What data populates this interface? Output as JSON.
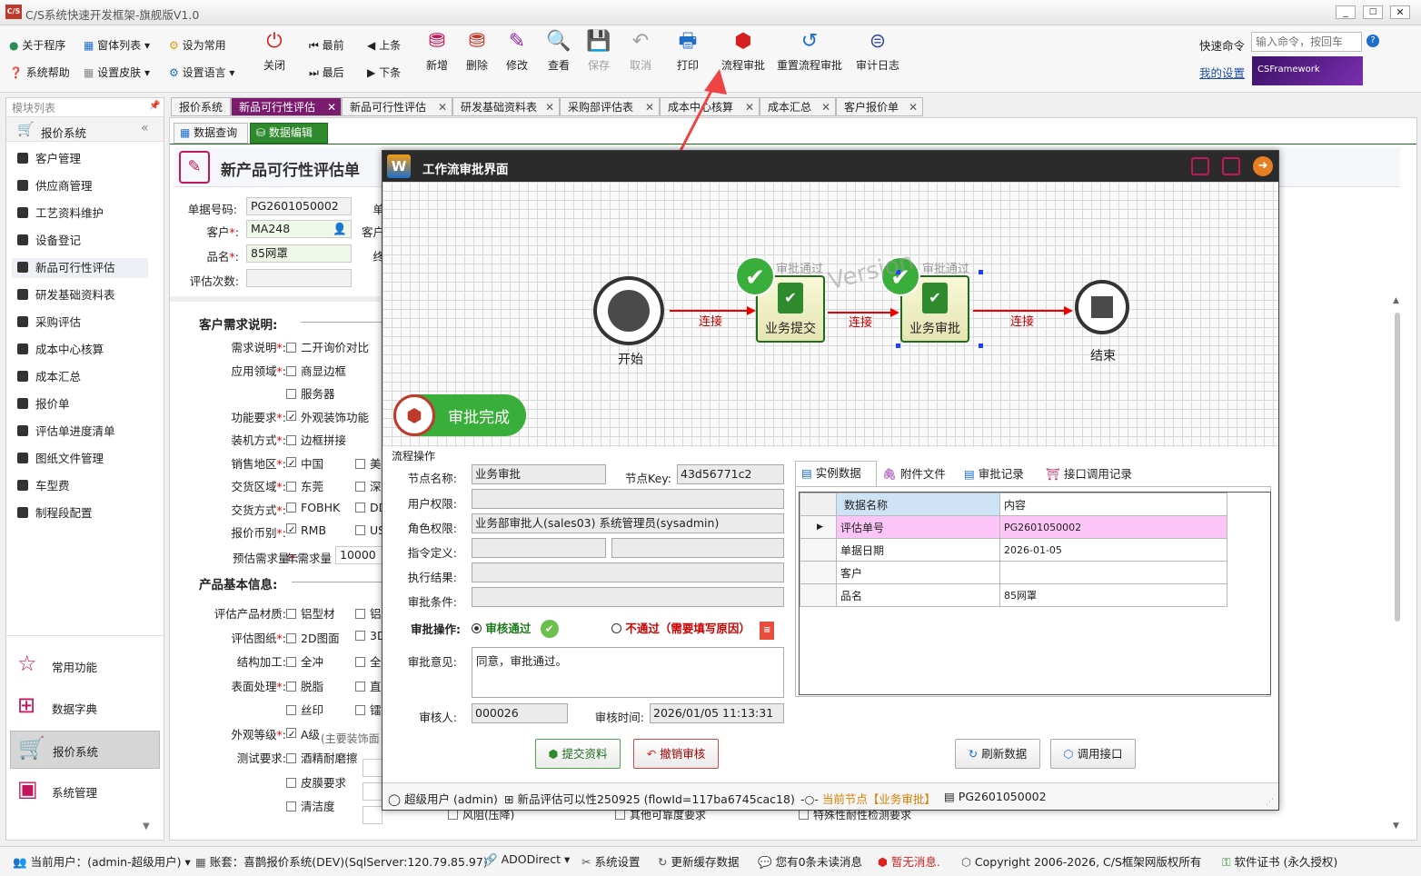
{
  "window": {
    "title": "C/S系统快速开发框架-旗舰版V1.0"
  },
  "toolbar": {
    "about": "关于程序",
    "help": "系统帮助",
    "window_list": "窗体列表",
    "skin": "设置皮肤",
    "set_common": "设为常用",
    "set_language": "设置语言",
    "close": "关闭",
    "first": "最前",
    "last": "最后",
    "prev": "上条",
    "next": "下条",
    "add": "新增",
    "delete": "删除",
    "edit": "修改",
    "view": "查看",
    "save": "保存",
    "cancel": "取消",
    "print": "打印",
    "flow_approve": "流程审批",
    "reset_flow": "重置流程审批",
    "audit_log": "审计日志",
    "quick_cmd_label": "快速命令",
    "quick_cmd_placeholder": "输入命令，按回车",
    "my_settings": "我的设置",
    "brand": "CSFramework"
  },
  "left_panel": {
    "header": "模块列表",
    "group": "报价系统",
    "items": [
      "客户管理",
      "供应商管理",
      "工艺资料维护",
      "设备登记",
      "新品可行性评估",
      "研发基础资料表",
      "采购评估",
      "成本中心核算",
      "成本汇总",
      "报价单",
      "评估单进度清单",
      "图纸文件管理",
      "车型费",
      "制程段配置"
    ],
    "bottom": [
      "常用功能",
      "数据字典",
      "报价系统",
      "系统管理"
    ]
  },
  "tabs": [
    "报价系统",
    "新品可行性评估",
    "新品可行性评估",
    "研发基础资料表",
    "采购部评估表",
    "成本中心核算",
    "成本汇总",
    "客户报价单"
  ],
  "subtabs": [
    "数据查询",
    "数据编辑"
  ],
  "form": {
    "title": "新产品可行性评估单",
    "doc_no_label": "单据号码:",
    "doc_no": "PG2601050002",
    "doc_extra_label": "单",
    "customer_label": "客户",
    "customer": "MA248",
    "customer_extra_label": "客户",
    "product_label": "品名",
    "product": "85网罩",
    "product_extra_label": "终",
    "eval_count_label": "评估次数:",
    "section1": "客户需求说明:",
    "rows1": [
      {
        "label": "需求说明",
        "req": true,
        "opts": [
          {
            "t": "二开询价对比",
            "on": false
          }
        ]
      },
      {
        "label": "应用领域",
        "req": true,
        "opts": [
          {
            "t": "商显边框",
            "on": false
          }
        ]
      },
      {
        "label": "",
        "req": false,
        "opts": [
          {
            "t": "服务器",
            "on": false
          }
        ]
      },
      {
        "label": "功能要求",
        "req": true,
        "opts": [
          {
            "t": "外观装饰功能",
            "on": true
          }
        ]
      },
      {
        "label": "装机方式",
        "req": true,
        "opts": [
          {
            "t": "边框拼接",
            "on": false
          }
        ]
      },
      {
        "label": "销售地区",
        "req": true,
        "opts": [
          {
            "t": "中国",
            "on": true
          },
          {
            "t": "美国",
            "on": false
          }
        ]
      },
      {
        "label": "交货区域",
        "req": true,
        "opts": [
          {
            "t": "东莞",
            "on": false
          },
          {
            "t": "深圳",
            "on": false
          }
        ]
      },
      {
        "label": "交货方式",
        "req": true,
        "opts": [
          {
            "t": "FOBHK",
            "on": false
          },
          {
            "t": "DDU",
            "on": false
          }
        ]
      },
      {
        "label": "报价币别",
        "req": true,
        "opts": [
          {
            "t": "RMB",
            "on": true
          },
          {
            "t": "USD",
            "on": false
          }
        ]
      }
    ],
    "forecast_label": "预估需求量",
    "annual_label": "年需求量",
    "annual_value": "10000",
    "section2": "产品基本信息:",
    "rows2": [
      {
        "label": "评估产品材质",
        "req": false,
        "opts": [
          {
            "t": "铝型材",
            "on": false
          },
          {
            "t": "铝",
            "on": false
          }
        ]
      },
      {
        "label": "评估图纸",
        "req": true,
        "opts": [
          {
            "t": "2D图面",
            "on": false
          },
          {
            "t": "3D",
            "on": false
          }
        ]
      },
      {
        "label": "结构加工",
        "req": false,
        "opts": [
          {
            "t": "全冲",
            "on": false
          },
          {
            "t": "全",
            "on": false
          }
        ]
      },
      {
        "label": "表面处理",
        "req": true,
        "opts": [
          {
            "t": "脱脂",
            "on": false
          },
          {
            "t": "直",
            "on": false
          }
        ]
      },
      {
        "label": "",
        "req": false,
        "opts": [
          {
            "t": "丝印",
            "on": false
          },
          {
            "t": "镭",
            "on": false
          }
        ]
      },
      {
        "label": "外观等级",
        "req": true,
        "opts": [
          {
            "t": "A级",
            "on": true
          }
        ]
      },
      {
        "label": "测试要求",
        "req": false,
        "opts": [
          {
            "t": "酒精耐磨擦",
            "on": false
          }
        ]
      },
      {
        "label": "",
        "req": false,
        "opts": [
          {
            "t": "皮膜要求",
            "on": false
          }
        ]
      },
      {
        "label": "",
        "req": false,
        "opts": [
          {
            "t": "清洁度",
            "on": false
          }
        ]
      }
    ],
    "grade_note": "(主要装饰面",
    "hidden1": "风阻(压降)",
    "hidden2": "其他可靠度要求",
    "hidden3": "特殊性耐性检测要求"
  },
  "dialog": {
    "title": "工作流审批界面",
    "canvas": {
      "start": "开始",
      "end": "结束",
      "submit_node": "业务提交",
      "approve_node": "业务审批",
      "passed": "审批通过",
      "link": "连接",
      "watermark": "Version",
      "badge": "审批完成"
    },
    "section": "流程操作",
    "node_name_label": "节点名称:",
    "node_name": "业务审批",
    "node_key_label": "节点Key:",
    "node_key": "43d56771c2",
    "user_perm_label": "用户权限:",
    "role_perm_label": "角色权限:",
    "role_perm": "业务部审批人(sales03) 系统管理员(sysadmin)",
    "cmd_label": "指令定义:",
    "result_label": "执行结果:",
    "cond_label": "审批条件:",
    "op_label": "审批操作:",
    "op_pass": "审核通过",
    "op_reject": "不通过（需要填写原因）",
    "opinion_label": "审批意见:",
    "opinion": "同意，审批通过。",
    "reviewer_label": "审核人:",
    "reviewer": "000026",
    "review_time_label": "审核时间:",
    "review_time": "2026/01/05 11:13:31",
    "tabs": [
      "实例数据",
      "附件文件",
      "审批记录",
      "接口调用记录"
    ],
    "grid_headers": [
      "数据名称",
      "内容"
    ],
    "grid_rows": [
      [
        "评估单号",
        "PG2601050002"
      ],
      [
        "单据日期",
        "2026-01-05"
      ],
      [
        "客户",
        ""
      ],
      [
        "品名",
        "85网罩"
      ]
    ],
    "btn_submit": "提交资料",
    "btn_revoke": "撤销审核",
    "btn_refresh": "刷新数据",
    "btn_api": "调用接口",
    "status_user": "超级用户 (admin)",
    "status_flow": "新品评估可以性250925 (flowId=117ba6745cac18)",
    "status_node": "当前节点【业务审批】",
    "status_doc": "PG2601050002"
  },
  "statusbar": {
    "user": "当前用户：(admin-超级用户)",
    "account": "账套：喜鹊报价系统(DEV)(SqlServer:120.79.85.97)",
    "ado": "ADODirect",
    "settings": "系统设置",
    "refresh": "更新缓存数据",
    "msgs": "您有0条未读消息",
    "nomsg": "暂无消息.",
    "copyright": "Copyright 2006-2026, C/S框架网版权所有",
    "cert": "软件证书 (永久授权)"
  }
}
